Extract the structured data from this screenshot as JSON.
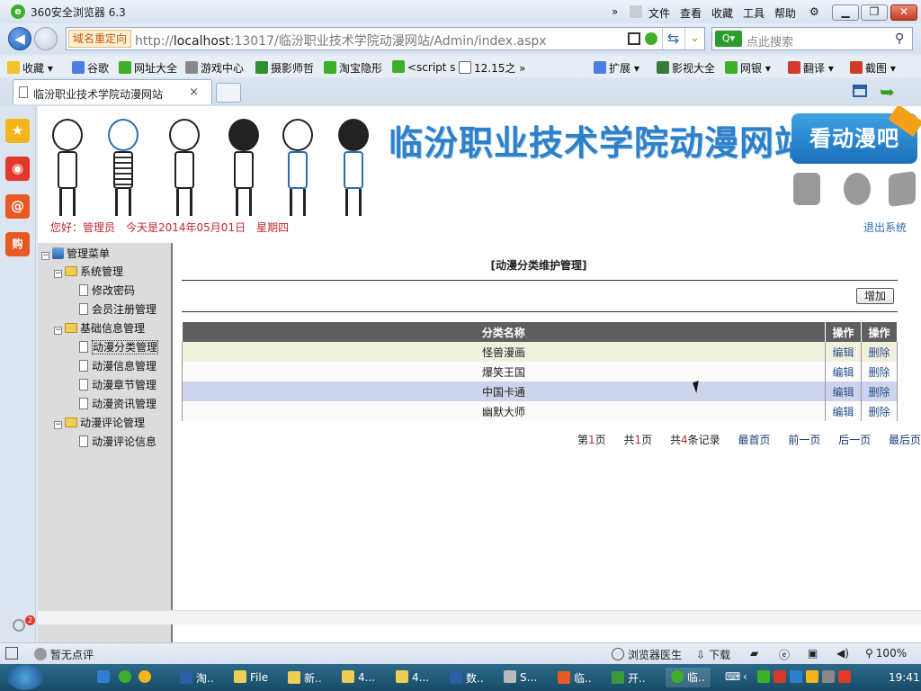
{
  "browser": {
    "title": "360安全浏览器 6.3",
    "menu": [
      "文件",
      "查看",
      "收藏",
      "工具",
      "帮助"
    ],
    "redirect_label": "域名重定向",
    "url_prefix": "http://",
    "url_host": "localhost",
    "url_rest": ":13017/临汾职业技术学院动漫网站/Admin/index.aspx",
    "search_placeholder": "点此搜索",
    "bookmarks_left": [
      "收藏",
      "谷歌",
      "网址大全",
      "游戏中心",
      "摄影师哲",
      "淘宝隐形",
      "<script s",
      "12.15之"
    ],
    "bookmarks_right": [
      "扩展",
      "影视大全",
      "网银",
      "翻译",
      "截图"
    ],
    "tab_title": "临汾职业技术学院动漫网站",
    "tab_close": "×",
    "min": "▁",
    "max": "❐",
    "close": "✕"
  },
  "site": {
    "title": "临汾职业技术学院动漫网站",
    "watch_button": "看动漫吧",
    "greeting": "您好：管理员　今天是2014年05月01日　星期四",
    "logout": "退出系统"
  },
  "sidemenu": {
    "root": "管理菜单",
    "groups": [
      {
        "label": "系统管理",
        "items": [
          "修改密码",
          "会员注册管理"
        ]
      },
      {
        "label": "基础信息管理",
        "items": [
          "动漫分类管理",
          "动漫信息管理",
          "动漫章节管理",
          "动漫资讯管理"
        ]
      },
      {
        "label": "动漫评论管理",
        "items": [
          "动漫评论信息"
        ]
      }
    ]
  },
  "content": {
    "title": "[动漫分类维护管理]",
    "add_button": "增加",
    "columns": [
      "分类名称",
      "操作",
      "操作"
    ],
    "rows": [
      {
        "name": "怪兽漫画",
        "edit": "编辑",
        "delete": "删除"
      },
      {
        "name": "爆笑王国",
        "edit": "编辑",
        "delete": "删除"
      },
      {
        "name": "中国卡通",
        "edit": "编辑",
        "delete": "删除"
      },
      {
        "name": "幽默大师",
        "edit": "编辑",
        "delete": "删除"
      }
    ],
    "pager": {
      "page_prefix": "第",
      "page_num": "1",
      "page_suffix": "页",
      "total_prefix": "共",
      "total_num": "1",
      "total_suffix": "页",
      "records_prefix": "共",
      "records_num": "4",
      "records_suffix": "条记录",
      "first": "最首页",
      "prev": "前一页",
      "next": "后一页",
      "last": "最后页"
    }
  },
  "statusbar": {
    "comment": "暂无点评",
    "doctor": "浏览器医生",
    "download": "下载",
    "zoom": "100%",
    "notification_count": "2"
  },
  "taskbar": {
    "items": [
      "淘..",
      "File",
      "新..",
      "4...",
      "4...",
      "数..",
      "S...",
      "临..",
      "开..",
      "临.."
    ],
    "clock": "19:41"
  }
}
